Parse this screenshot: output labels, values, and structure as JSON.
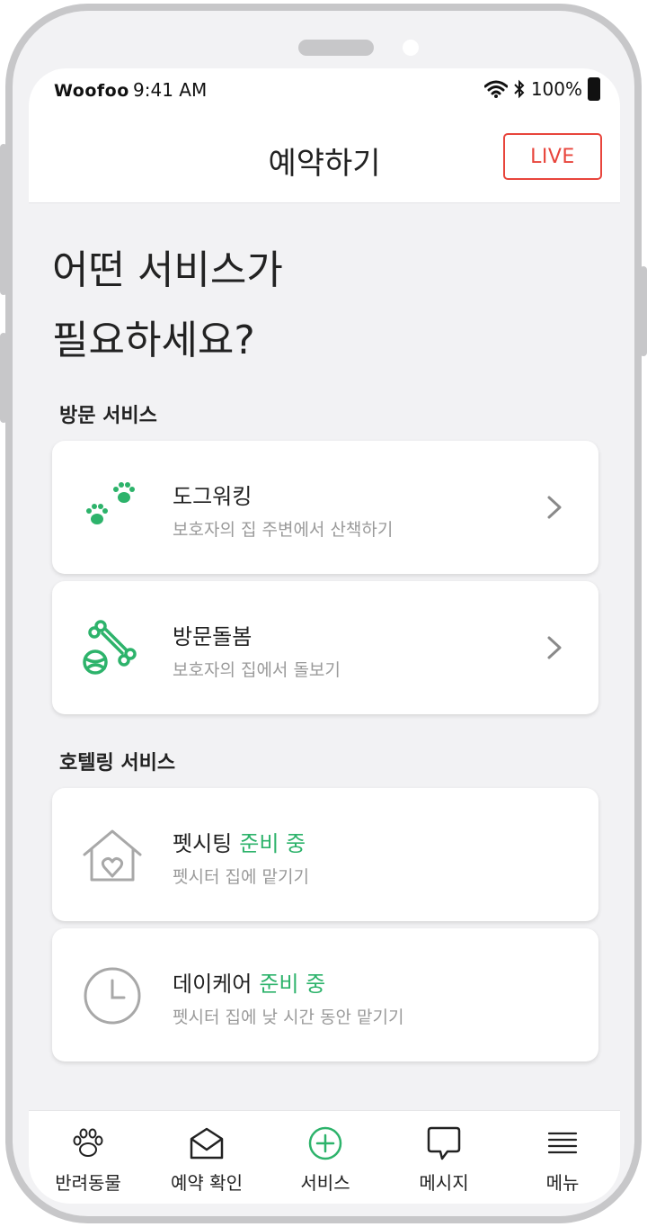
{
  "status_bar": {
    "carrier": "Woofoo",
    "time": "9:41 AM",
    "battery": "100%"
  },
  "header": {
    "title": "예약하기",
    "live_label": "LIVE"
  },
  "headline": {
    "line1": "어떤 서비스가",
    "line2": "필요하세요?"
  },
  "sections": [
    {
      "title": "방문 서비스",
      "items": [
        {
          "name": "도그워킹",
          "status": "",
          "desc": "보호자의 집 주변에서 산책하기",
          "icon": "paw-prints-icon"
        },
        {
          "name": "방문돌봄",
          "status": "",
          "desc": "보호자의 집에서 돌보기",
          "icon": "bone-ball-icon"
        }
      ]
    },
    {
      "title": "호텔링 서비스",
      "items": [
        {
          "name": "펫시팅",
          "status": "준비 중",
          "desc": "펫시터 집에 맡기기",
          "icon": "house-heart-icon"
        },
        {
          "name": "데이케어",
          "status": "준비 중",
          "desc": "펫시터 집에 낮 시간 동안 맡기기",
          "icon": "clock-icon"
        }
      ]
    }
  ],
  "tabbar": [
    {
      "label": "반려동물",
      "icon": "paw-icon"
    },
    {
      "label": "예약 확인",
      "icon": "envelope-icon"
    },
    {
      "label": "서비스",
      "icon": "plus-circle-icon"
    },
    {
      "label": "메시지",
      "icon": "chat-bubble-icon"
    },
    {
      "label": "메뉴",
      "icon": "hamburger-menu-icon"
    }
  ],
  "colors": {
    "accent_green": "#2db36b",
    "live_red": "#e8453c",
    "disabled_gray": "#a8a8a8"
  }
}
